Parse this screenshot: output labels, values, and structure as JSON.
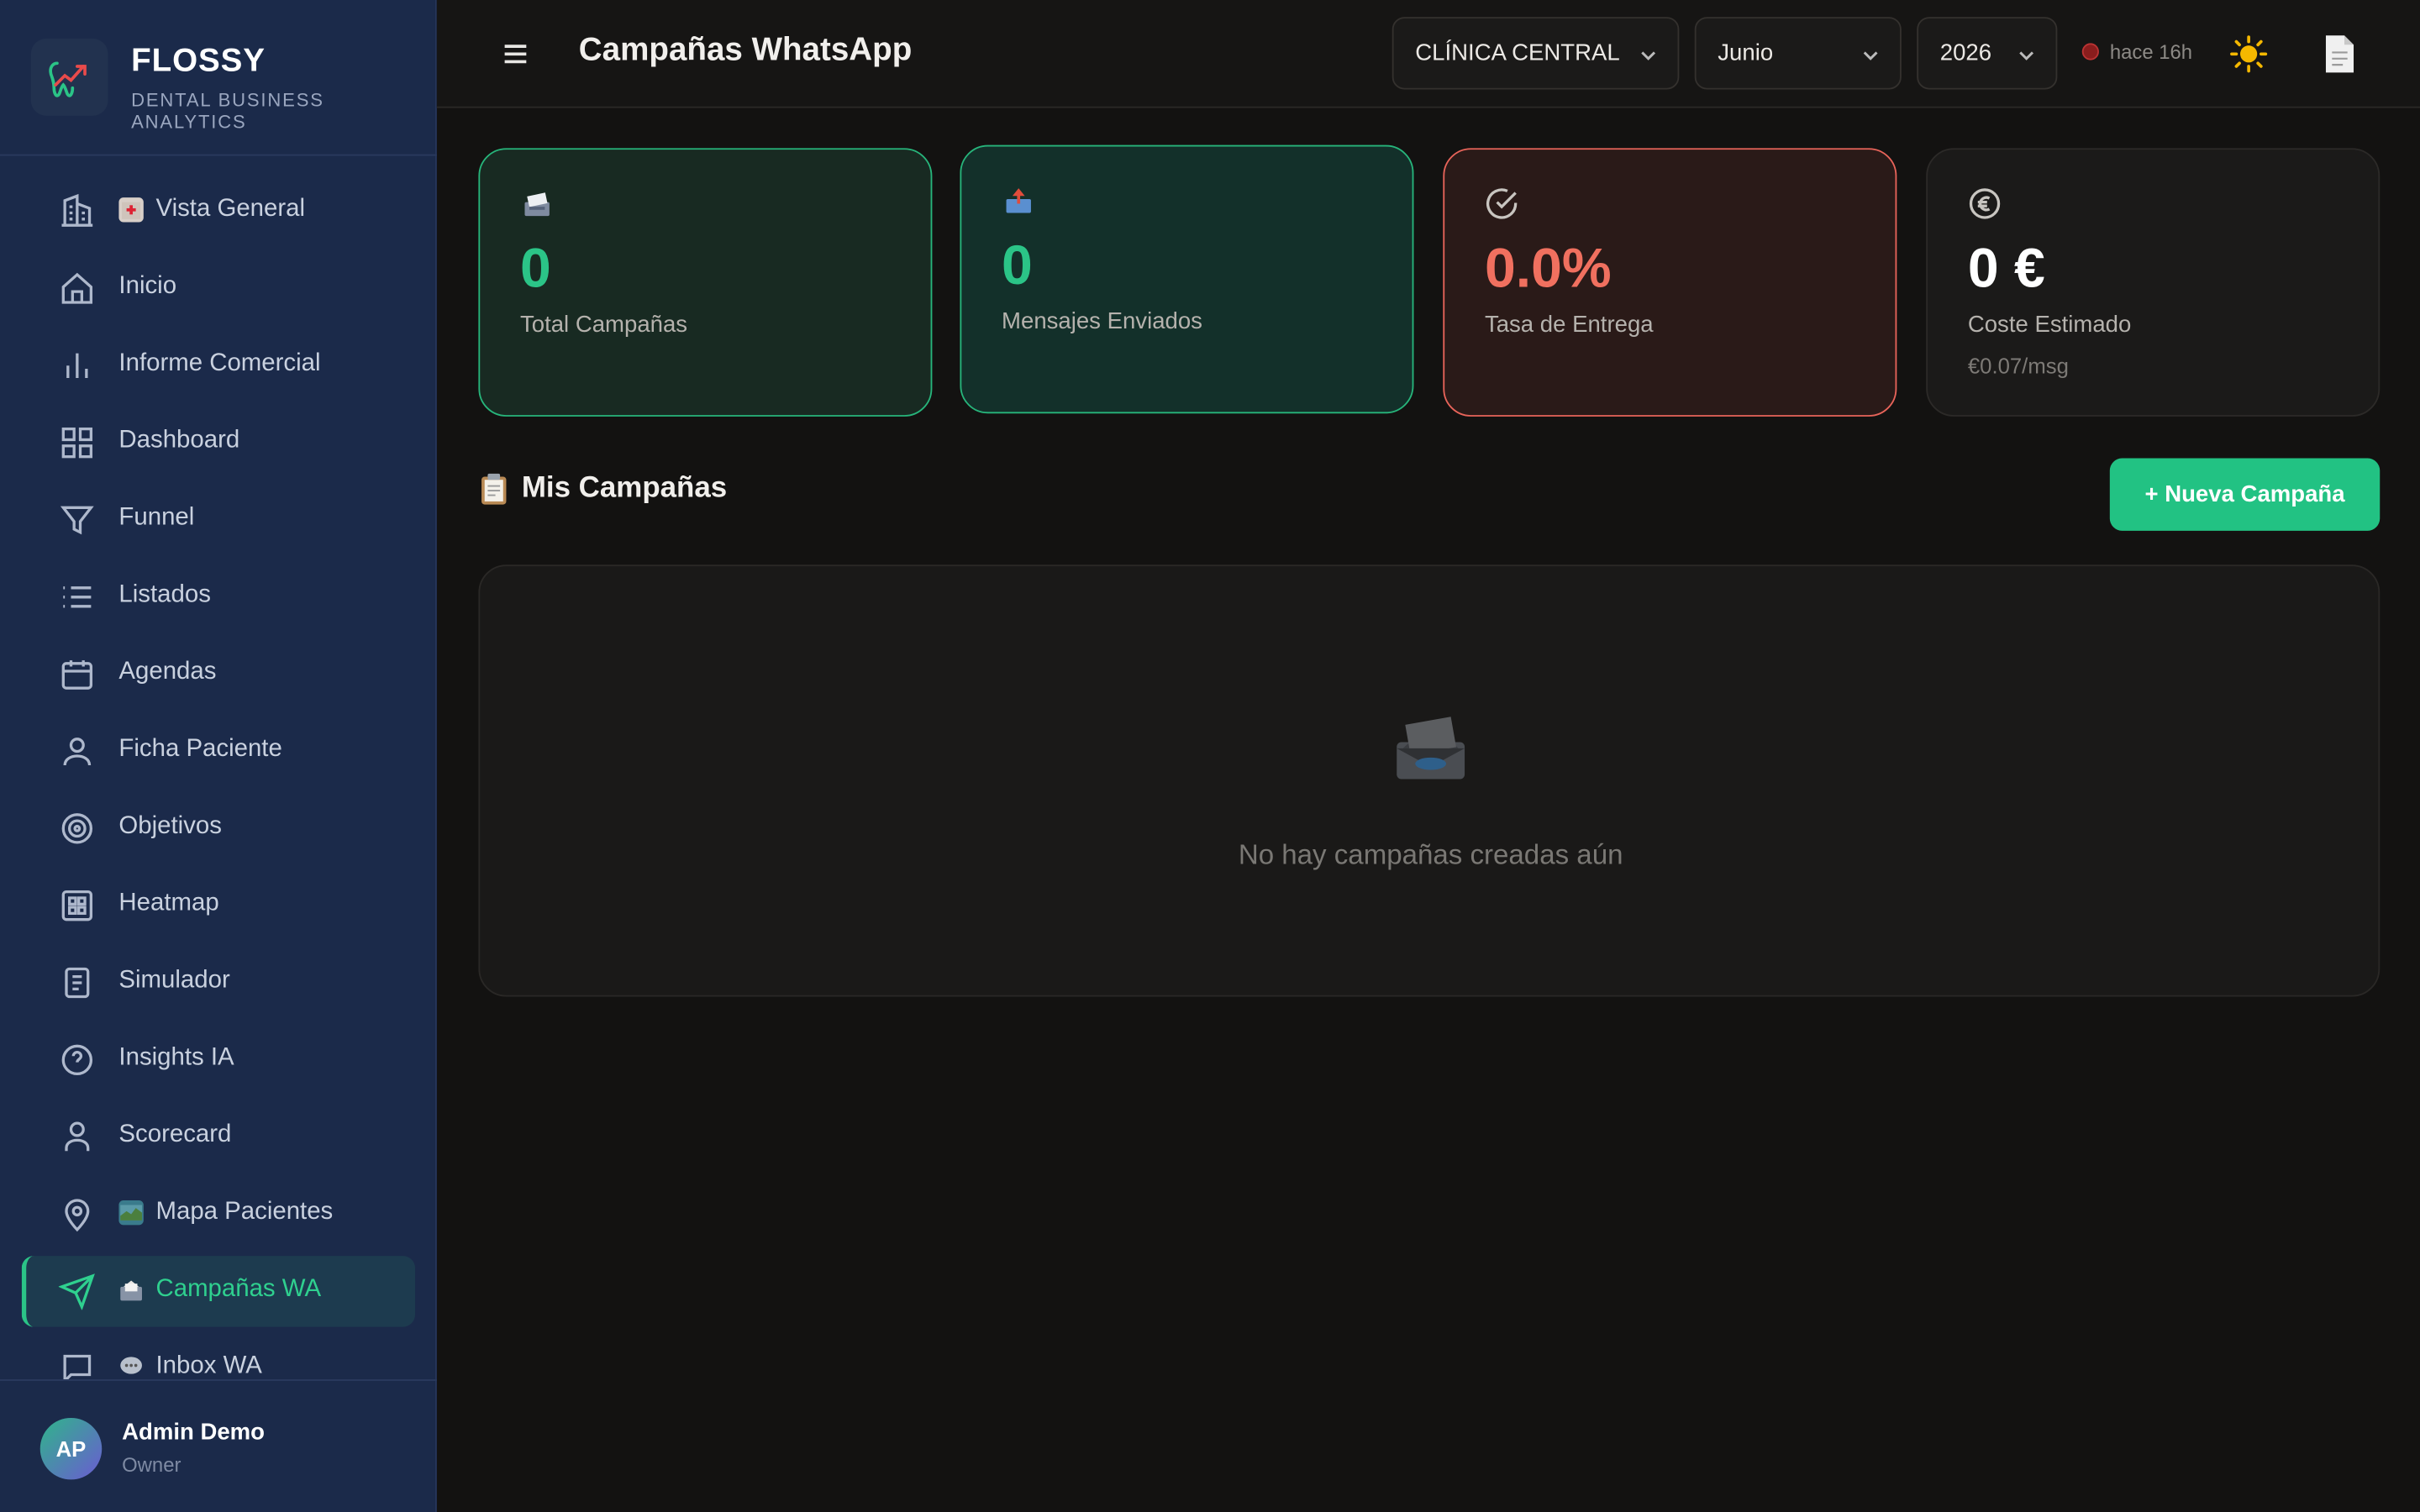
{
  "brand": {
    "name": "FLOSSY",
    "subtitle": "DENTAL BUSINESS ANALYTICS"
  },
  "sidebar": {
    "items": [
      {
        "label": "Vista General",
        "icon": "building-icon",
        "emoji": "hospital"
      },
      {
        "label": "Inicio",
        "icon": "home-icon"
      },
      {
        "label": "Informe Comercial",
        "icon": "bar-chart-icon"
      },
      {
        "label": "Dashboard",
        "icon": "grid-icon"
      },
      {
        "label": "Funnel",
        "icon": "funnel-icon"
      },
      {
        "label": "Listados",
        "icon": "list-icon"
      },
      {
        "label": "Agendas",
        "icon": "calendar-icon"
      },
      {
        "label": "Ficha Paciente",
        "icon": "user-icon"
      },
      {
        "label": "Objetivos",
        "icon": "target-icon"
      },
      {
        "label": "Heatmap",
        "icon": "heatmap-icon"
      },
      {
        "label": "Simulador",
        "icon": "document-icon"
      },
      {
        "label": "Insights IA",
        "icon": "help-circle-icon"
      },
      {
        "label": "Scorecard",
        "icon": "user-check-icon"
      },
      {
        "label": "Mapa Pacientes",
        "icon": "map-pin-icon",
        "emoji": "map"
      },
      {
        "label": "Campañas WA",
        "icon": "send-icon",
        "emoji": "inbox",
        "active": true
      },
      {
        "label": "Inbox WA",
        "icon": "message-icon",
        "emoji": "speech-bubble"
      }
    ]
  },
  "user": {
    "initials": "AP",
    "name": "Admin Demo",
    "role": "Owner"
  },
  "header": {
    "title": "Campañas WhatsApp",
    "clinic": "CLÍNICA CENTRAL",
    "month": "Junio",
    "year": "2026",
    "status": "hace 16h"
  },
  "stats": [
    {
      "value": "0",
      "label": "Total Campañas",
      "color": "#2bc487"
    },
    {
      "value": "0",
      "label": "Mensajes Enviados",
      "color": "#2bc487"
    },
    {
      "value": "0.0%",
      "label": "Tasa de Entrega",
      "color": "#f0705f"
    },
    {
      "value": "0 €",
      "label": "Coste Estimado",
      "sublabel": "€0.07/msg",
      "color": "#ffffff"
    }
  ],
  "campaigns": {
    "title": "Mis Campañas",
    "new_button": "+ Nueva Campaña",
    "empty_text": "No hay campañas creadas aún"
  },
  "colors": {
    "accent": "#22c283",
    "sidebar_bg": "#1b2a4a",
    "danger": "#f0705f"
  }
}
